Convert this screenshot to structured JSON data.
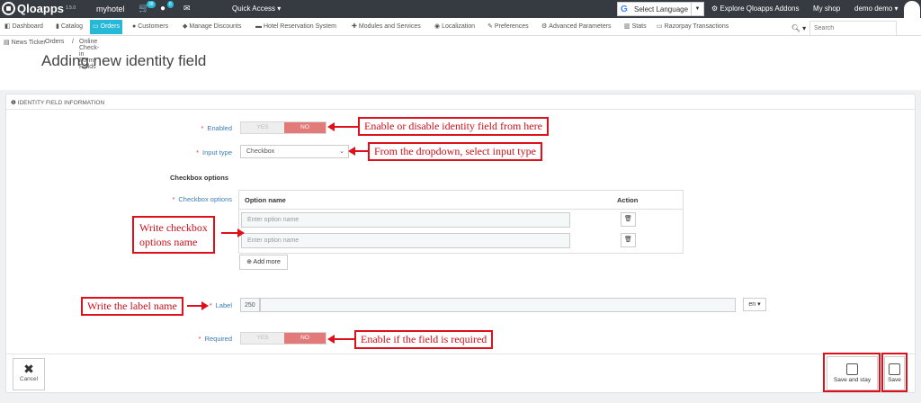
{
  "topbar": {
    "brand": "Qloapps",
    "version": "1.5.0",
    "shop_name": "myhotel",
    "orders_badge": "38",
    "customers_badge": "6",
    "quick_access": "Quick Access",
    "language_label": "Select Language",
    "explore": "Explore Qloapps Addons",
    "my_shop": "My shop",
    "employee": "demo demo"
  },
  "menu": {
    "items": [
      "Dashboard",
      "Catalog",
      "Orders",
      "Customers",
      "Manage Discounts",
      "Hotel Reservation System",
      "Modules and Services",
      "Localization",
      "Preferences",
      "Advanced Parameters",
      "Stats",
      "Razorpay Transactions"
    ],
    "search_placeholder": "Search"
  },
  "breadcrumb": {
    "news": "News Ticker",
    "orders": "Orders",
    "separator": "/",
    "current": "Online Check-in Form Fields"
  },
  "page_title": "Adding new identity field",
  "panel": {
    "heading": "IDENTITY FIELD INFORMATION",
    "enabled_label": "Enabled",
    "yes": "YES",
    "no": "NO",
    "input_type_label": "Input type",
    "input_type_value": "Checkbox",
    "checkbox_options_heading": "Checkbox options",
    "checkbox_options_label": "Checkbox options",
    "col_option_name": "Option name",
    "col_action": "Action",
    "option_placeholder": "Enter option name",
    "add_more": "Add more",
    "label_label": "Label",
    "label_counter": "250",
    "lang": "en",
    "required_label": "Required"
  },
  "footer": {
    "cancel": "Cancel",
    "save_and_stay": "Save and stay",
    "save": "Save"
  },
  "annotations": {
    "enable": "Enable or disable identity field from here",
    "dropdown": "From the dropdown, select input type",
    "checkbox_line1": "Write checkbox",
    "checkbox_line2": "options name",
    "label": "Write the label name",
    "required": "Enable if the field is required"
  },
  "colors": {
    "topbar": "#363a41",
    "accent": "#25b9d7",
    "switch_no": "#e27a7a",
    "annotation_red": "#e0101a"
  }
}
